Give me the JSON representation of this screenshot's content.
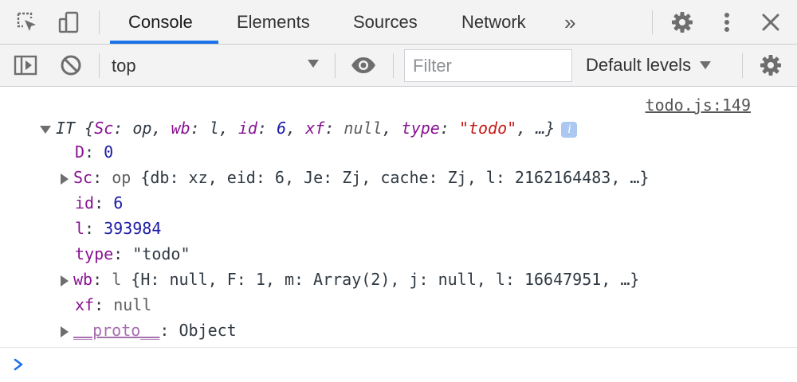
{
  "tabs": [
    {
      "label": "Console",
      "active": true
    },
    {
      "label": "Elements",
      "active": false
    },
    {
      "label": "Sources",
      "active": false
    },
    {
      "label": "Network",
      "active": false
    }
  ],
  "icons": {
    "inspect": "inspect-element-icon",
    "device": "device-toolbar-icon",
    "more_tabs": "chevron-double-right-icon",
    "settings": "gear-icon",
    "menu": "kebab-menu-icon",
    "close": "close-icon",
    "sidebar": "show-sidebar-icon",
    "clear": "clear-console-icon",
    "eye": "live-expression-eye-icon",
    "console_settings": "gear-icon",
    "more_tabs_glyph": "»"
  },
  "toolbar": {
    "context": "top",
    "filter_placeholder": "Filter",
    "levels_label": "Default levels"
  },
  "console": {
    "source": "todo.js:149",
    "header": {
      "name": "IT",
      "open": "{",
      "props": [
        {
          "key": "Sc",
          "value": "op",
          "type": "obj"
        },
        {
          "key": "wb",
          "value": "l",
          "type": "obj"
        },
        {
          "key": "id",
          "value": "6",
          "type": "num"
        },
        {
          "key": "xf",
          "value": "null",
          "type": "null"
        },
        {
          "key": "type",
          "value": "\"todo\"",
          "type": "str"
        }
      ],
      "tail": ", …}",
      "info": "i"
    },
    "rows": [
      {
        "key": "D",
        "value": "0"
      },
      {
        "key": "Sc",
        "name": "op",
        "preview": "{db: xz, eid: 6, Je: Zj, cache: Zj, l: 2162164483, …}"
      },
      {
        "key": "id",
        "value": "6"
      },
      {
        "key": "l",
        "value": "393984"
      },
      {
        "key": "type",
        "value": "\"todo\""
      },
      {
        "key": "wb",
        "name": "l",
        "preview": "{H: null, F: 1, m: Array(2), j: null, l: 16647951, …}"
      },
      {
        "key": "xf",
        "value": "null"
      },
      {
        "key": "__proto__",
        "value": "Object"
      }
    ]
  },
  "colors": {
    "accent": "#1a73e8",
    "key": "#881391",
    "number": "#1a1aa6",
    "string": "#c41a16"
  }
}
